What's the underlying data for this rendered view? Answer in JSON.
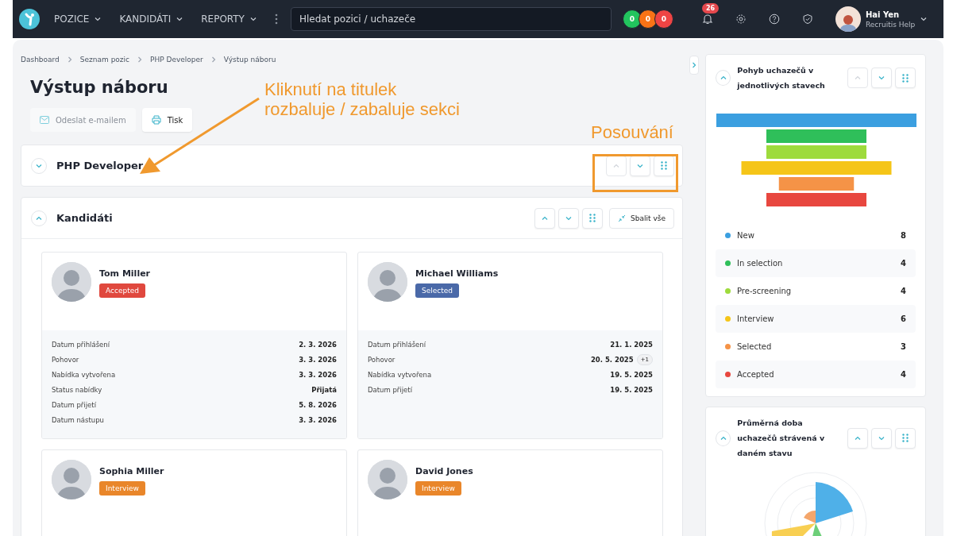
{
  "topbar": {
    "nav": [
      {
        "label": "POZICE"
      },
      {
        "label": "KANDIDÁTI"
      },
      {
        "label": "REPORTY"
      }
    ],
    "search": {
      "placeholder": "Hledat pozici / uchazeče"
    },
    "counters": [
      {
        "label": "0",
        "color": "#22c55e"
      },
      {
        "label": "0",
        "color": "#f97316"
      },
      {
        "label": "0",
        "color": "#ef4444"
      }
    ],
    "notification_count": "26",
    "user": {
      "name": "Hai Yen",
      "subtitle": "Recruitis Help"
    }
  },
  "breadcrumb": [
    "Dashboard",
    "Seznam pozic",
    "PHP Developer",
    "Výstup náboru"
  ],
  "title": "Výstup náboru",
  "actions": [
    {
      "label": "Odeslat e-mailem",
      "kind": "mail",
      "disabled": true
    },
    {
      "label": "Tisk",
      "kind": "print",
      "disabled": false
    }
  ],
  "annotations": [
    {
      "lines": [
        "Kliknutí na titulek",
        "rozbaluje / zabaluje sekci"
      ],
      "kind": "arrow"
    },
    {
      "lines": [
        "Posouvání"
      ],
      "kind": "frame"
    }
  ],
  "sections": [
    {
      "title": "PHP Developer",
      "expanded": false,
      "up_disabled": true
    },
    {
      "title": "Kandidáti",
      "expanded": true,
      "up_disabled": false,
      "collapse_all": "Sbalit vše",
      "candidates": [
        {
          "name": "Tom Miller",
          "status": "Accepted",
          "color": "#e0483e",
          "fields": [
            {
              "label": "Datum přihlášení",
              "value": "2. 3. 2026"
            },
            {
              "label": "Pohovor",
              "value": "3. 3. 2026"
            },
            {
              "label": "Nabídka vytvořena",
              "value": "3. 3. 2026"
            },
            {
              "label": "Status nabídky",
              "value": "Přijatá"
            },
            {
              "label": "Datum přijetí",
              "value": "5. 8. 2026"
            },
            {
              "label": "Datum nástupu",
              "value": "3. 3. 2026"
            }
          ]
        },
        {
          "name": "Michael Williams",
          "status": "Selected",
          "color": "#4a69a8",
          "fields": [
            {
              "label": "Datum přihlášení",
              "value": "21. 1. 2025"
            },
            {
              "label": "Pohovor",
              "value": "20. 5. 2025",
              "extra": "+1"
            },
            {
              "label": "Nabídka vytvořena",
              "value": "19. 5. 2025"
            },
            {
              "label": "Datum přijetí",
              "value": "19. 5. 2025"
            }
          ]
        },
        {
          "name": "Sophia Miller",
          "status": "Interview",
          "color": "#e9862a"
        },
        {
          "name": "David Jones",
          "status": "Interview",
          "color": "#e9862a"
        }
      ]
    }
  ],
  "widgets": [
    {
      "title": "Pohyb uchazečů v jednotlivých stavech",
      "kind": "funnel",
      "up_disabled": true,
      "legend": [
        {
          "label": "New",
          "count": "8",
          "color": "#3b9fe0"
        },
        {
          "label": "In selection",
          "count": "4",
          "color": "#2fbf5a"
        },
        {
          "label": "Pre-screening",
          "count": "4",
          "color": "#9edb3c"
        },
        {
          "label": "Interview",
          "count": "6",
          "color": "#f5c518"
        },
        {
          "label": "Selected",
          "count": "3",
          "color": "#f59347"
        },
        {
          "label": "Accepted",
          "count": "4",
          "color": "#e8473f"
        }
      ]
    },
    {
      "title": "Průměrná doba uchazečů strávená v daném stavu",
      "kind": "polar",
      "up_disabled": false
    }
  ]
}
